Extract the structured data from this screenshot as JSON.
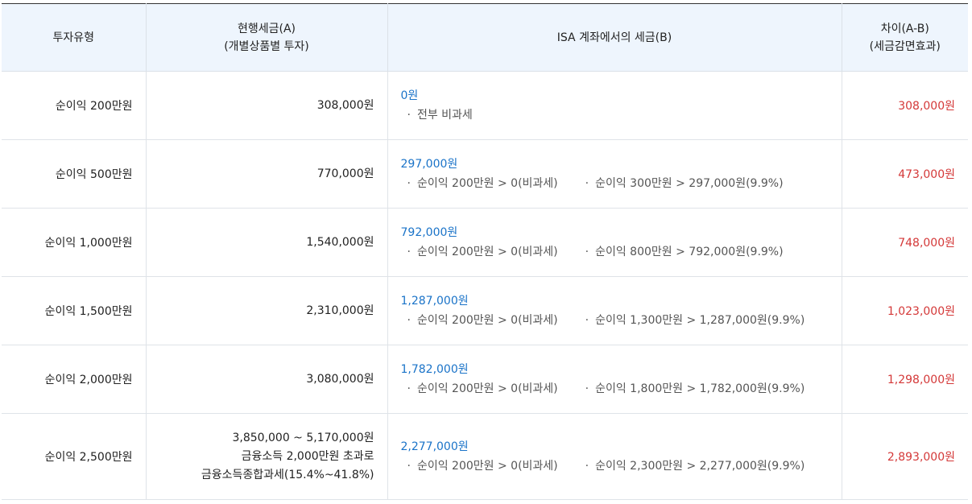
{
  "headers": {
    "type": "투자유형",
    "current_line1": "현행세금(A)",
    "current_line2": "(개별상품별 투자)",
    "isa": "ISA 계좌에서의 세금(B)",
    "diff_line1": "차이(A-B)",
    "diff_line2": "(세금감면효과)"
  },
  "rows": [
    {
      "type": "순이익 200만원",
      "current": [
        "308,000원"
      ],
      "isa_amount": "0원",
      "isa_notes": [
        "전부 비과세"
      ],
      "diff": "308,000원"
    },
    {
      "type": "순이익 500만원",
      "current": [
        "770,000원"
      ],
      "isa_amount": "297,000원",
      "isa_notes": [
        "순이익 200만원 > 0(비과세)",
        "순이익 300만원 > 297,000원(9.9%)"
      ],
      "diff": "473,000원"
    },
    {
      "type": "순이익 1,000만원",
      "current": [
        "1,540,000원"
      ],
      "isa_amount": "792,000원",
      "isa_notes": [
        "순이익 200만원 > 0(비과세)",
        "순이익 800만원 > 792,000원(9.9%)"
      ],
      "diff": "748,000원"
    },
    {
      "type": "순이익 1,500만원",
      "current": [
        "2,310,000원"
      ],
      "isa_amount": "1,287,000원",
      "isa_notes": [
        "순이익 200만원 > 0(비과세)",
        "순이익 1,300만원 > 1,287,000원(9.9%)"
      ],
      "diff": "1,023,000원"
    },
    {
      "type": "순이익 2,000만원",
      "current": [
        "3,080,000원"
      ],
      "isa_amount": "1,782,000원",
      "isa_notes": [
        "순이익 200만원 > 0(비과세)",
        "순이익 1,800만원 > 1,782,000원(9.9%)"
      ],
      "diff": "1,298,000원"
    },
    {
      "type": "순이익 2,500만원",
      "current": [
        "3,850,000 ~ 5,170,000원",
        "금융소득 2,000만원 초과로",
        "금융소득종합과세(15.4%~41.8%)"
      ],
      "isa_amount": "2,277,000원",
      "isa_notes": [
        "순이익 200만원 > 0(비과세)",
        "순이익 2,300만원 > 2,277,000원(9.9%)"
      ],
      "diff": "2,893,000원"
    }
  ],
  "bullet": "·",
  "colors": {
    "header_bg": "#eef5fd",
    "amount_blue": "#1a73c8",
    "diff_red": "#d43838"
  }
}
